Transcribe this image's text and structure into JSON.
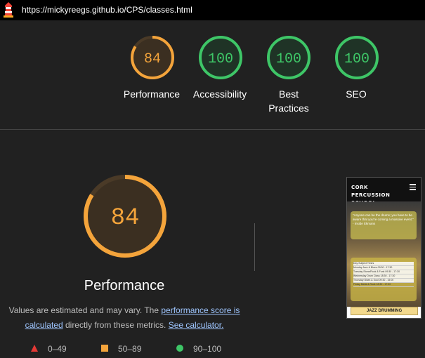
{
  "browser": {
    "url": "https://mickyreegs.github.io/CPS/classes.html",
    "logo_icon": "lighthouse-icon"
  },
  "summary_gauges": [
    {
      "label": "Performance",
      "score": "84",
      "color": "#f4a43b"
    },
    {
      "label": "Accessibility",
      "score": "100",
      "color": "#3ec667"
    },
    {
      "label": "Best Practices",
      "score": "100",
      "color": "#3ec667"
    },
    {
      "label": "SEO",
      "score": "100",
      "color": "#3ec667"
    }
  ],
  "performance": {
    "score": "84",
    "label": "Performance",
    "desc_prefix": "Values are estimated and may vary. The ",
    "link_score": "performance score is calculated",
    "desc_middle": " directly from these metrics. ",
    "link_calc": "See calculator."
  },
  "legend": [
    {
      "range": "0–49",
      "shape": "triangle",
      "color": "#e53935"
    },
    {
      "range": "50–89",
      "shape": "square",
      "color": "#f4a43b"
    },
    {
      "range": "90–100",
      "shape": "circle",
      "color": "#3ec667"
    }
  ],
  "thumbnail": {
    "site_title": "CORK PERCUSSION SCHOOL",
    "quote": "\"Anyone can be the drums; you have to be aware that you're coming a massive event.\" - Inside Ekmans",
    "table_headers": [
      "Day",
      "Subject",
      "Times"
    ],
    "table_rows": [
      [
        "Monday",
        "Jazz & Blues",
        "09:30 - 17:30"
      ],
      [
        "Tuesday",
        "Stone/Rock & Funk",
        "09:30 - 17:30"
      ],
      [
        "Wednesday",
        "Drum Class",
        "18:30 - 17:30"
      ],
      [
        "Thursday",
        "Blues & Soul",
        "09:30 - 15:00"
      ],
      [
        "Friday",
        "Metal & Rock",
        "18:30 - 17:30"
      ]
    ],
    "caption": "JAZZ DRUMMING"
  }
}
